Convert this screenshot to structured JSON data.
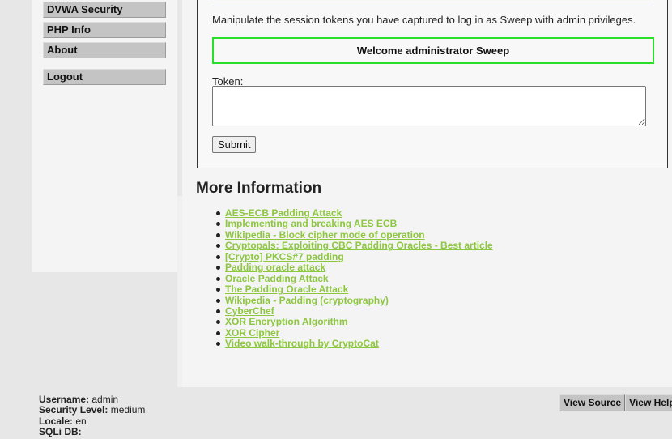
{
  "sidebar": {
    "items": [
      {
        "label": "DVWA Security"
      },
      {
        "label": "PHP Info"
      },
      {
        "label": "About"
      }
    ],
    "logout_label": "Logout"
  },
  "main": {
    "instructions": "Manipulate the session tokens you have captured to log in as Sweep with admin privileges.",
    "welcome_message": "Welcome administrator Sweep",
    "token_label": "Token:",
    "token_value": "",
    "submit_label": "Submit"
  },
  "more_info": {
    "heading": "More Information",
    "links": [
      "AES-ECB Padding Attack",
      "Implementing and breaking AES ECB",
      "Wikipedia - Block cipher mode of operation",
      "Cryptopals: Exploiting CBC Padding Oracles - Best article",
      "[Crypto] PKCS#7 padding",
      "Padding oracle attack",
      "Oracle Padding Attack",
      "The Padding Oracle Attack",
      "Wikipedia - Padding (cryptography)",
      "CyberChef",
      "XOR Encryption Algorithm",
      "XOR Cipher",
      "Video walk-through by CryptoCat"
    ]
  },
  "footer": {
    "username_label": "Username:",
    "username": "admin",
    "security_label": "Security Level:",
    "security": "medium",
    "locale_label": "Locale:",
    "locale": "en",
    "sqli_label": "SQLi DB:",
    "sqli": "",
    "view_source_label": "View Source",
    "view_help_label": "View Help"
  },
  "colors": {
    "link": "#8dc63f",
    "welcome_border": "#28e028",
    "menu_button": "#c4c4c4"
  }
}
